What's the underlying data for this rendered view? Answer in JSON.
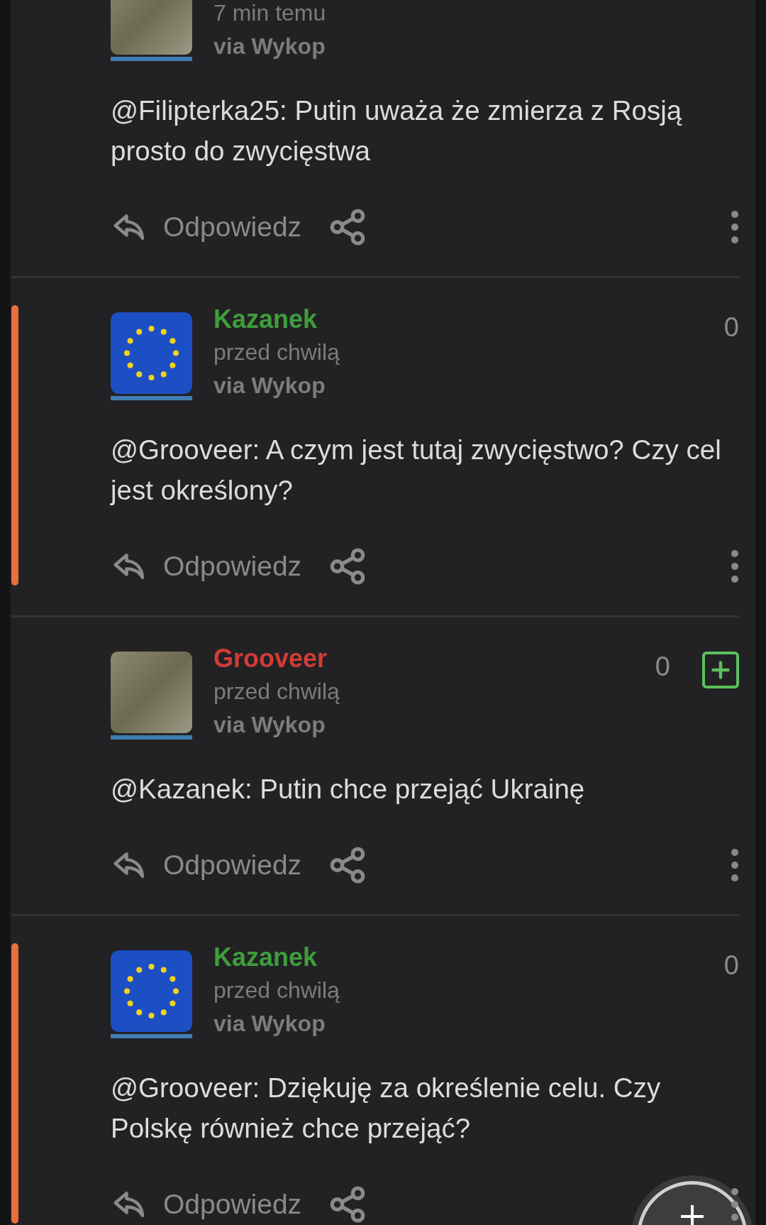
{
  "comments": [
    {
      "avatar": {
        "kind": "photo"
      },
      "time": "7 min temu",
      "via": "via Wykop",
      "text": "@Filipterka25: Putin uważa że zmierza z Rosją prosto do zwycięstwa",
      "reply": "Odpowiedz",
      "highlighted": false
    },
    {
      "author": {
        "name": "Kazanek",
        "color": "#3f9e3b"
      },
      "avatar": {
        "kind": "flag"
      },
      "time": "przed chwilą",
      "via": "via Wykop",
      "score": "0",
      "text": "@Grooveer: A czym jest tutaj zwycięstwo? Czy cel jest określony?",
      "reply": "Odpowiedz",
      "highlighted": true
    },
    {
      "author": {
        "name": "Grooveer",
        "color": "#d13c37"
      },
      "avatar": {
        "kind": "photo"
      },
      "time": "przed chwilą",
      "via": "via Wykop",
      "score": "0",
      "vote_button": true,
      "text": "@Kazanek: Putin chce przejąć Ukrainę",
      "reply": "Odpowiedz",
      "highlighted": false
    },
    {
      "author": {
        "name": "Kazanek",
        "color": "#3f9e3b"
      },
      "avatar": {
        "kind": "flag"
      },
      "time": "przed chwilą",
      "via": "via Wykop",
      "score": "0",
      "text": "@Grooveer: Dziękuję za określenie celu. Czy Polskę również chce przejąć?",
      "reply": "Odpowiedz",
      "highlighted": true
    }
  ]
}
